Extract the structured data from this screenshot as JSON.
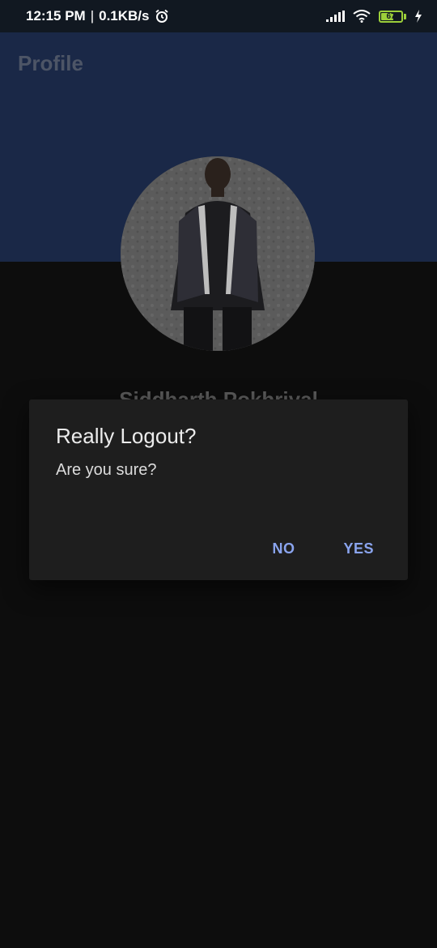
{
  "status_bar": {
    "time": "12:15 PM",
    "separator": "|",
    "speed": "0.1KB/s",
    "battery_level": "67"
  },
  "header": {
    "title": "Profile"
  },
  "profile": {
    "name": "Siddharth Pokhriyal"
  },
  "dialog": {
    "title": "Really Logout?",
    "message": "Are you sure?",
    "no_label": "NO",
    "yes_label": "YES"
  },
  "colors": {
    "header_band": "#1a2847",
    "background": "#0d0d0d",
    "dialog_background": "#1e1e1e",
    "accent": "#8aa4ee",
    "battery": "#9ccf3a"
  },
  "icons": {
    "alarm": "alarm-clock-icon",
    "signal": "cellular-signal-icon",
    "wifi": "wifi-icon",
    "battery": "battery-icon",
    "charging": "lightning-bolt-icon"
  }
}
